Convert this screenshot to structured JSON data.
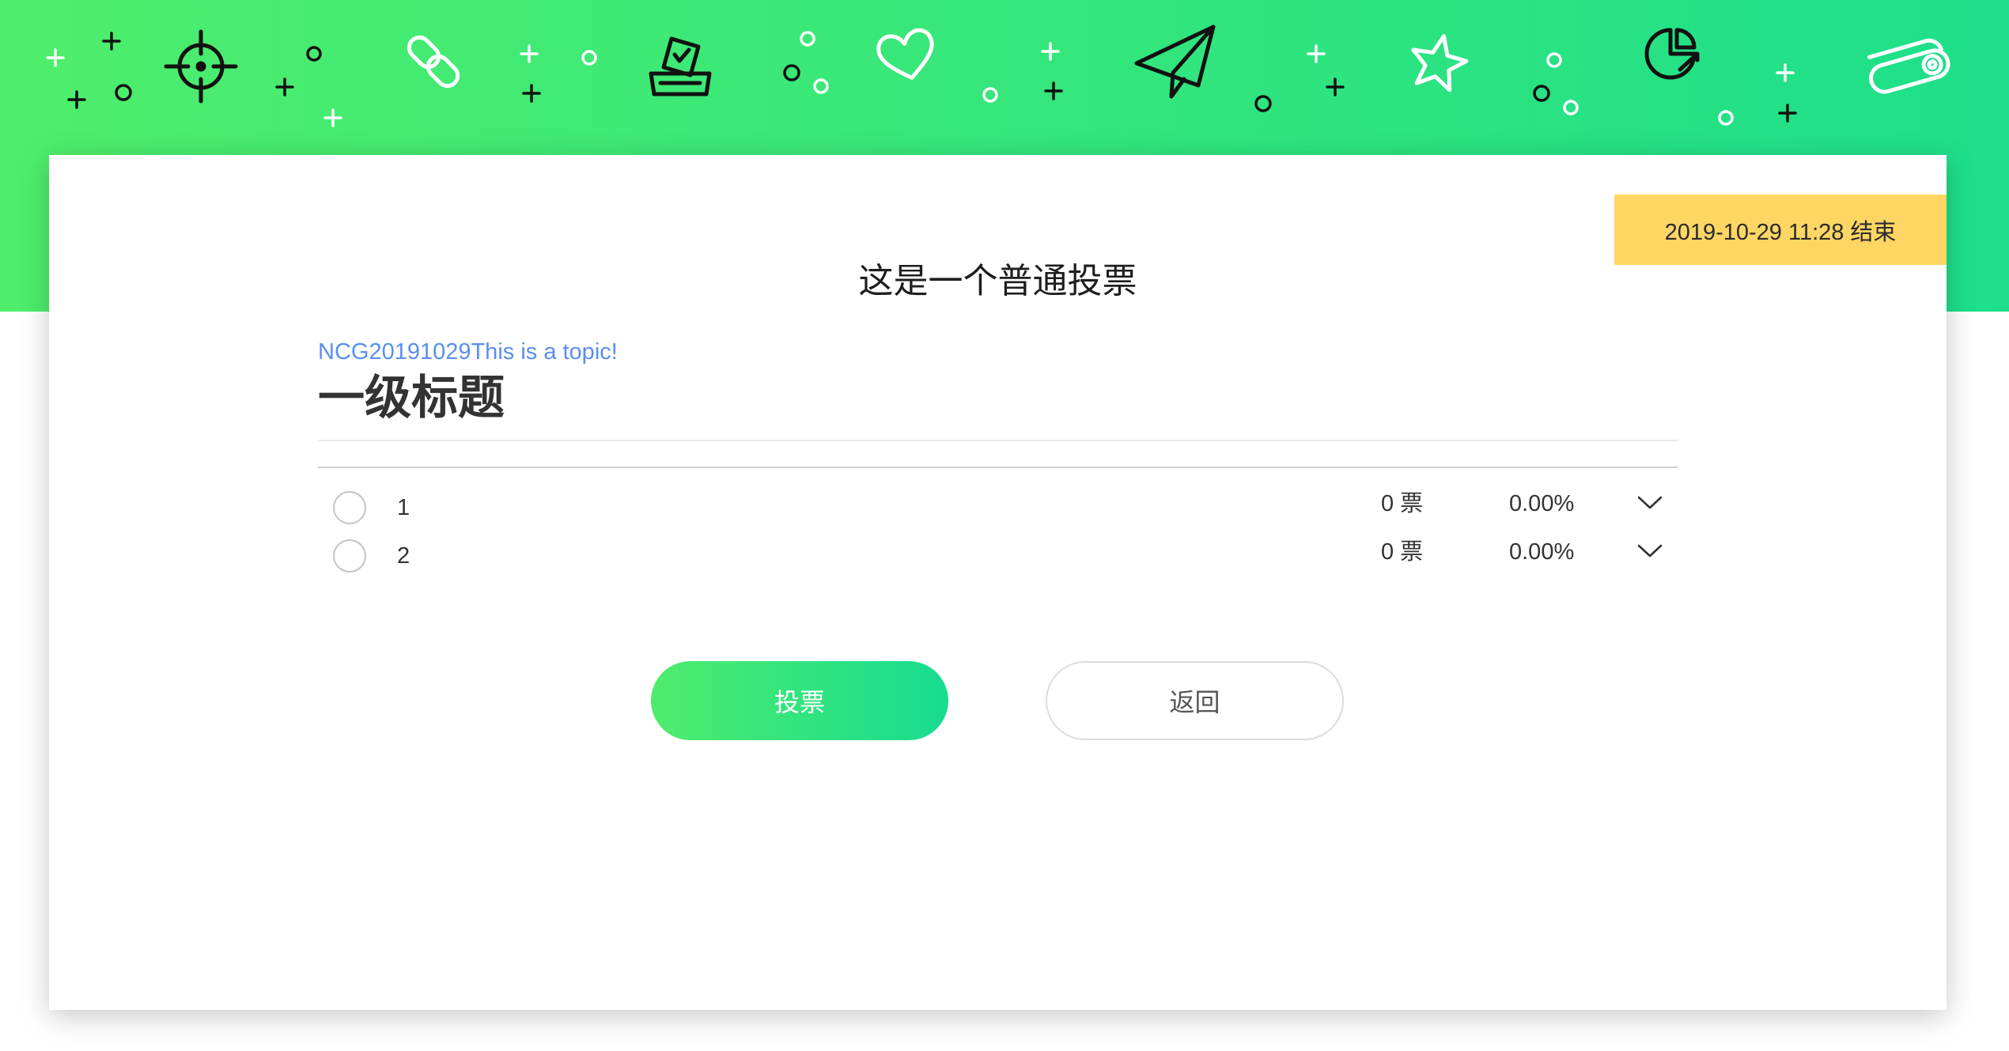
{
  "vote": {
    "end_badge": "2019-10-29 11:28 结束",
    "title": "这是一个普通投票",
    "topic": "NCG20191029This is a topic!",
    "heading": "一级标题",
    "options": [
      {
        "label": "1",
        "votes": "0 票",
        "percent": "0.00%"
      },
      {
        "label": "2",
        "votes": "0 票",
        "percent": "0.00%"
      }
    ]
  },
  "actions": {
    "vote_label": "投票",
    "back_label": "返回"
  },
  "banner": {
    "icons": [
      "crosshair-icon",
      "link-icon",
      "ballot-box-icon",
      "heart-icon",
      "paper-plane-icon",
      "star-icon",
      "pie-chart-icon",
      "toggle-icon"
    ]
  },
  "theme": {
    "banner_from": "#4eee6b",
    "banner_to": "#1ddf8a",
    "badge": "#ffd664",
    "topic_blue": "#5a8ef0",
    "vote_from": "#4eec6c",
    "vote_to": "#16dc91"
  }
}
